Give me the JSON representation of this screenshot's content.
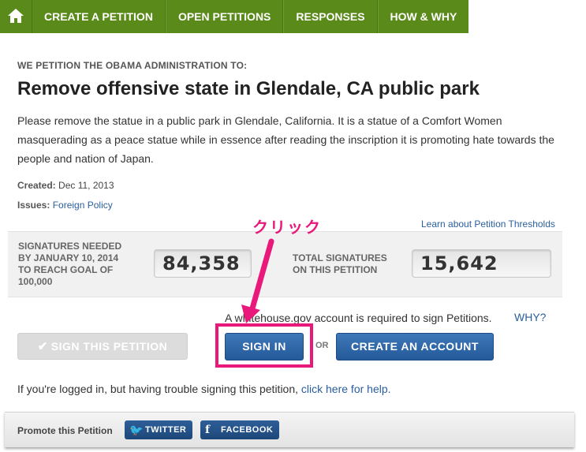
{
  "nav": {
    "home_icon": "home-icon",
    "items": [
      {
        "label": "CREATE A PETITION"
      },
      {
        "label": "OPEN PETITIONS"
      },
      {
        "label": "RESPONSES"
      },
      {
        "label": "HOW & WHY"
      }
    ]
  },
  "petition": {
    "kicker": "WE PETITION THE OBAMA ADMINISTRATION TO:",
    "title": "Remove offensive state in Glendale, CA public park",
    "description": "Please remove the statue in a public park in Glendale, California. It is a statue of a Comfort Women masquerading as a peace statue while in essence after reading the inscription it is promoting hate towards the people and nation of Japan.",
    "created_label": "Created:",
    "created_value": "Dec 11, 2013",
    "issues_label": "Issues:",
    "issues_value": "Foreign Policy",
    "thresholds_link": "Learn about Petition Thresholds"
  },
  "signatures": {
    "needed_label_1": "SIGNATURES NEEDED",
    "needed_label_2": "BY JANUARY 10, 2014",
    "needed_label_3": "TO REACH GOAL OF",
    "needed_label_4": "100,000",
    "needed_value": "84,358",
    "total_label_1": "TOTAL SIGNATURES",
    "total_label_2": "ON THIS PETITION",
    "total_value": "15,642"
  },
  "annotation": {
    "text": "クリック",
    "color": "#e8197b"
  },
  "actions": {
    "requirement": "A whitehouse.gov account is required to sign Petitions.",
    "why": "WHY?",
    "sign_label": "SIGN THIS PETITION",
    "signin_label": "SIGN IN",
    "or": "OR",
    "create_label": "CREATE AN ACCOUNT",
    "help_text": "If you're logged in, but having trouble signing this petition,",
    "help_link": "click here for help."
  },
  "promote": {
    "label": "Promote this Petition",
    "twitter": "TWITTER",
    "facebook": "FACEBOOK"
  },
  "colors": {
    "nav_green": "#5a8a1a",
    "link_blue": "#2a5f9e",
    "button_blue": "#24599a",
    "annotation_pink": "#e8197b"
  }
}
